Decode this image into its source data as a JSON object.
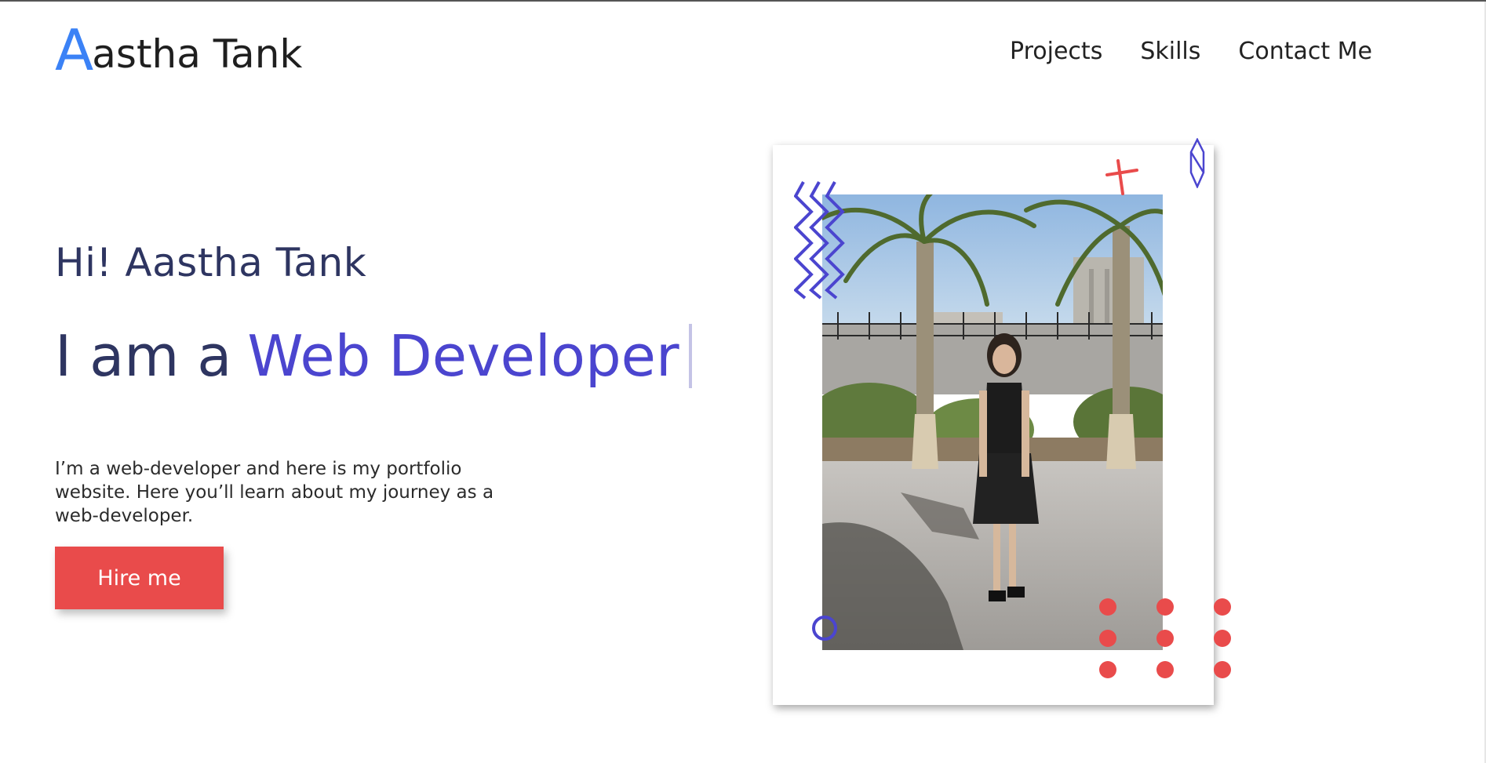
{
  "brand": {
    "initial": "A",
    "rest": "astha Tank",
    "accent_color": "#3b82f6"
  },
  "nav": {
    "items": [
      {
        "label": "Projects"
      },
      {
        "label": "Skills"
      },
      {
        "label": "Contact Me"
      }
    ]
  },
  "hero": {
    "greeting": "Hi! Aastha Tank",
    "role_prefix": "I am a",
    "role_highlight": "Web Developer",
    "intro": "I’m a web-developer and here is my portfolio website. Here you’ll learn about my journey as a web-developer.",
    "cta_label": "Hire me",
    "colors": {
      "heading": "#2e3561",
      "highlight": "#4b45cf",
      "cta": "#e94b4b"
    }
  },
  "photo_card": {
    "image": "portrait-photo",
    "decorations": [
      "zigzag-icon",
      "cross-icon",
      "diamond-icon",
      "circle-icon",
      "dot-grid"
    ]
  }
}
